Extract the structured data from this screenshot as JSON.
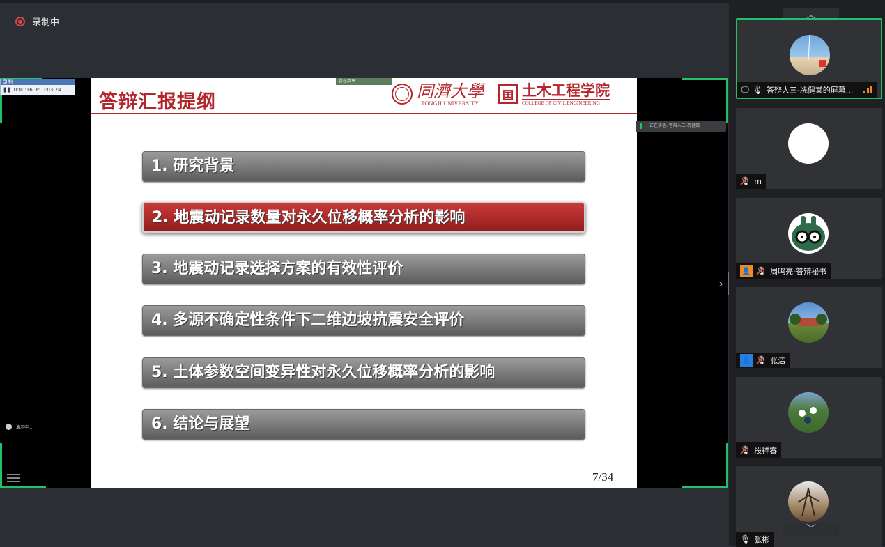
{
  "recording": {
    "label": "录制中"
  },
  "shared_screen": {
    "mini_toolbar": {
      "title": "录制",
      "elapsed": "0:00:16",
      "total": "0:03:24"
    },
    "sharing_bar": {
      "label": "我在共享"
    },
    "speaking_tip": {
      "text": "正在讲话: 答辩人三-冼健棠"
    },
    "bottom_status": {
      "text": "演示中..."
    }
  },
  "slide": {
    "title": "答辩汇报提纲",
    "logo": {
      "university_cn": "同濟大學",
      "university_en": "TONGJI UNIVERSITY",
      "college_cn": "土木工程学院",
      "college_en": "COLLEGE OF CIVIL ENGINEERING"
    },
    "items": [
      {
        "label": "1. 研究背景",
        "active": false
      },
      {
        "label": "2. 地震动记录数量对永久位移概率分析的影响",
        "active": true
      },
      {
        "label": "3. 地震动记录选择方案的有效性评价",
        "active": false
      },
      {
        "label": "4. 多源不确定性条件下二维边坡抗震安全评价",
        "active": false
      },
      {
        "label": "5. 土体参数空间变异性对永久位移概率分析的影响",
        "active": false
      },
      {
        "label": "6. 结论与展望",
        "active": false
      }
    ],
    "page_number": "7/34"
  },
  "participants": [
    {
      "name": "答辩人三-冼健棠的屏幕...",
      "mic": "on",
      "badge": "screen",
      "active": true,
      "avatar": "road-sky"
    },
    {
      "name": "m",
      "mic": "muted",
      "badge": "none",
      "active": false,
      "avatar": "white-doc"
    },
    {
      "name": "周鸣亮-答辩秘书",
      "mic": "muted",
      "badge": "orange",
      "active": false,
      "avatar": "cartoon"
    },
    {
      "name": "张洁",
      "mic": "muted",
      "badge": "blue",
      "active": false,
      "avatar": "campus"
    },
    {
      "name": "段祥睿",
      "mic": "muted",
      "badge": "none",
      "active": false,
      "avatar": "field"
    },
    {
      "name": "张彬",
      "mic": "on",
      "badge": "none",
      "active": false,
      "avatar": "tree"
    }
  ],
  "colors": {
    "accent_green": "#23c06a",
    "slide_red": "#b3262b",
    "record_red": "#d94848"
  }
}
